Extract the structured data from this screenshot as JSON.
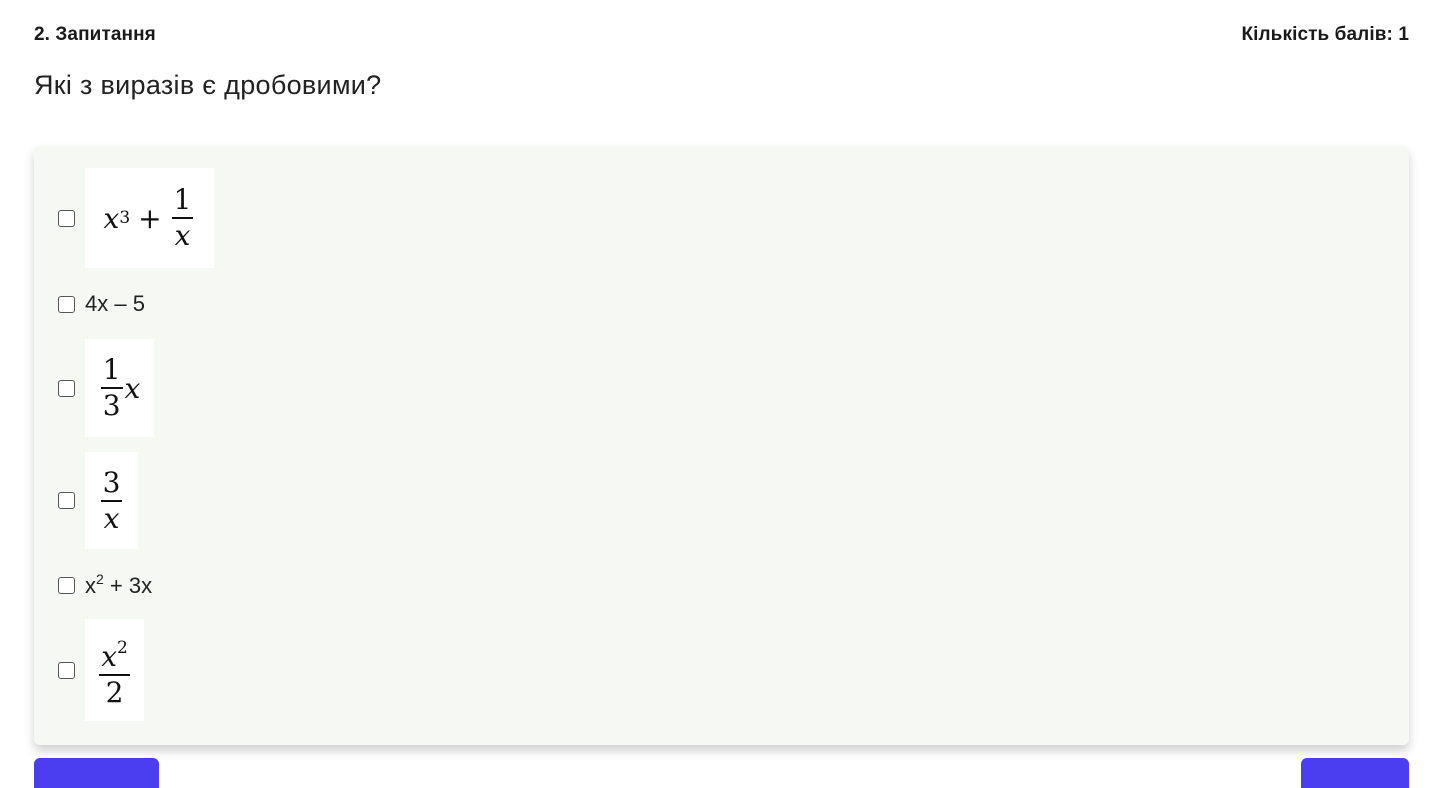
{
  "header": {
    "question_number": "2. Запитання",
    "points": "Кількість балів: 1"
  },
  "question": {
    "text": "Які з виразів є дробовими?"
  },
  "options": {
    "o1": {
      "base": "x",
      "exp": "3",
      "plus": "+",
      "num": "1",
      "den": "x"
    },
    "o2": {
      "text": "4x – 5"
    },
    "o3": {
      "num": "1",
      "den": "3",
      "var": "x"
    },
    "o4": {
      "num": "3",
      "den": "x"
    },
    "o5": {
      "base": "x",
      "exp": "2",
      "rest": " + 3x"
    },
    "o6": {
      "base": "x",
      "exp": "2",
      "den": "2"
    }
  },
  "colors": {
    "accent": "#4a3ef0",
    "panel_bg": "#f6f8f4"
  }
}
